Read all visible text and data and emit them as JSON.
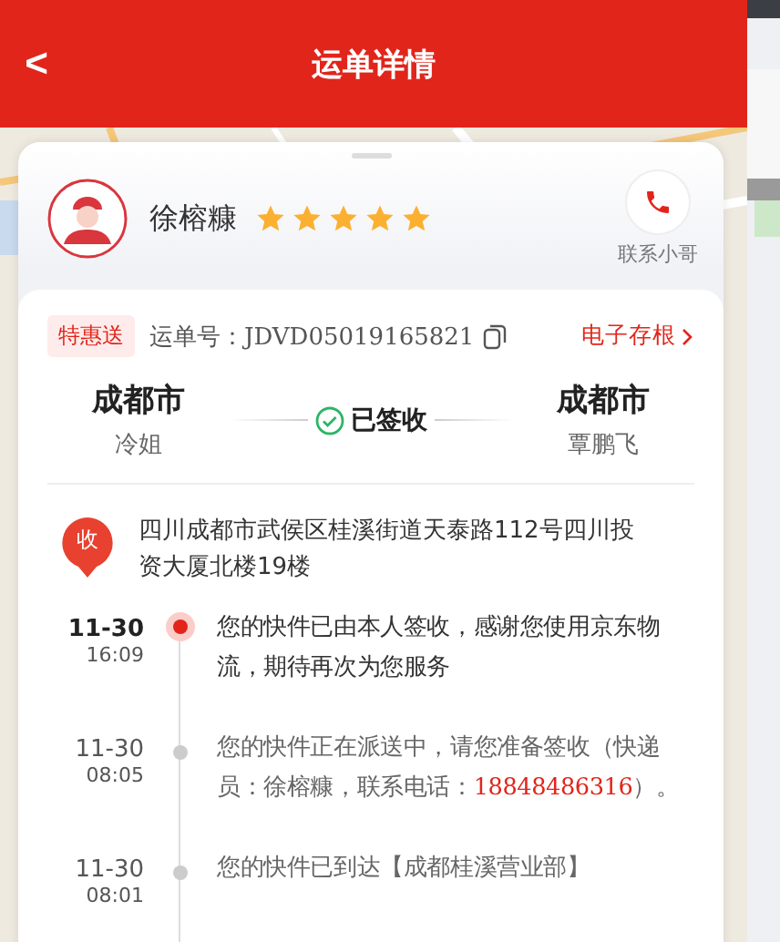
{
  "header": {
    "title": "运单详情",
    "back": "<"
  },
  "courier": {
    "name": "徐榕糠",
    "stars": 5,
    "contact_label": "联系小哥"
  },
  "waybill": {
    "tag": "特惠送",
    "number": "运单号：JDVD05019165821",
    "stub_link": "电子存根"
  },
  "route": {
    "from": {
      "city": "成都市",
      "person": "冷姐"
    },
    "status": "已签收",
    "to": {
      "city": "成都市",
      "person": "覃鹏飞"
    }
  },
  "address": {
    "badge": "收",
    "text": "四川成都市武侯区桂溪街道天泰路112号四川投资大厦北楼19楼"
  },
  "events": [
    {
      "date": "11-30",
      "time": "16:09",
      "current": true,
      "parts": [
        {
          "kind": "text",
          "text": "您的快件已由本人签收，感谢您使用京东物流，期待再次为您服务"
        }
      ]
    },
    {
      "date": "11-30",
      "time": "08:05",
      "current": false,
      "parts": [
        {
          "kind": "text",
          "text": "您的快件正在派送中，请您准备签收（快递员：徐榕糠，联系电话："
        },
        {
          "kind": "phone",
          "text": "18848486316"
        },
        {
          "kind": "text",
          "text": "）。"
        }
      ]
    },
    {
      "date": "11-30",
      "time": "08:01",
      "current": false,
      "parts": [
        {
          "kind": "text",
          "text": "您的快件已到达【成都桂溪营业部】"
        }
      ]
    }
  ]
}
